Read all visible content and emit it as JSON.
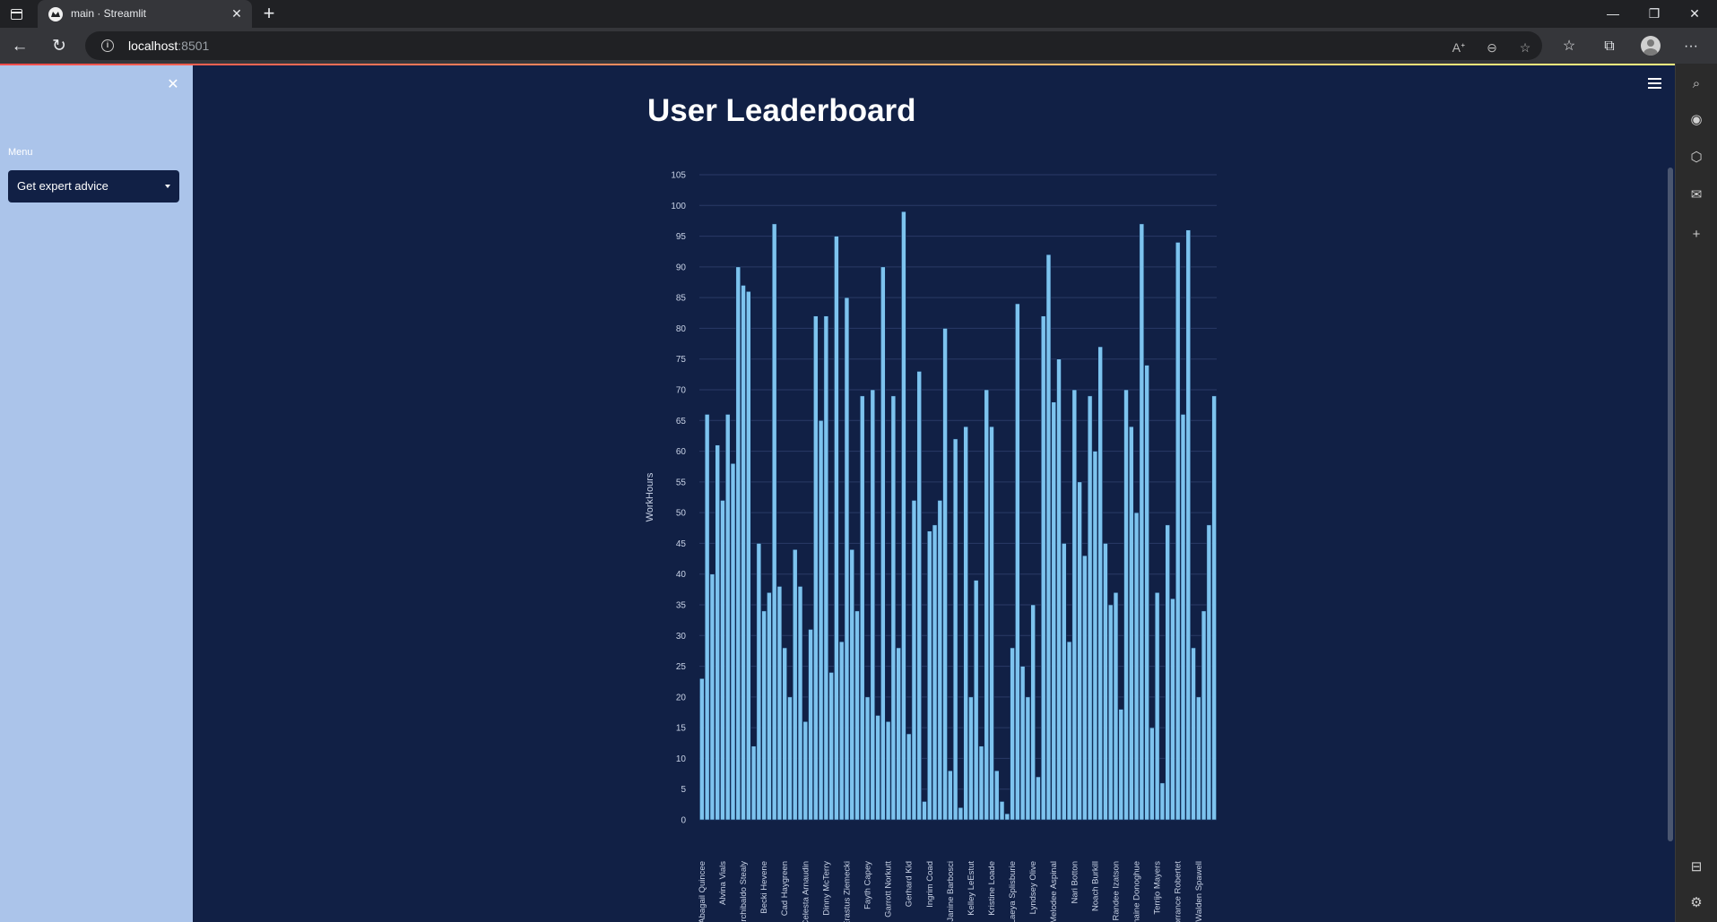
{
  "browser": {
    "tab_title": "main · Streamlit",
    "url_host": "localhost",
    "url_port": ":8501"
  },
  "sidebar": {
    "label": "Menu",
    "select_value": "Get expert advice"
  },
  "page": {
    "title": "User Leaderboard"
  },
  "colors": {
    "app_bg": "#112045",
    "sidebar_bg": "#abc4ea",
    "bar_fill": "#7dc3ee",
    "bar_stroke": "#0e2a55",
    "grid": "#2a3a66"
  },
  "chart_data": {
    "type": "bar",
    "title": "",
    "xlabel": "",
    "ylabel": "WorkHours",
    "ylim": [
      0,
      105
    ],
    "yticks": [
      0,
      5,
      10,
      15,
      20,
      25,
      30,
      35,
      40,
      45,
      50,
      55,
      60,
      65,
      70,
      75,
      80,
      85,
      90,
      95,
      100,
      105
    ],
    "grid": true,
    "values": [
      23,
      66,
      40,
      61,
      52,
      66,
      58,
      90,
      87,
      86,
      12,
      45,
      34,
      37,
      97,
      38,
      28,
      20,
      44,
      38,
      16,
      31,
      82,
      65,
      82,
      24,
      95,
      29,
      85,
      44,
      34,
      69,
      20,
      70,
      17,
      90,
      16,
      69,
      28,
      99,
      14,
      52,
      73,
      3,
      47,
      48,
      52,
      80,
      8,
      62,
      2,
      64,
      20,
      39,
      12,
      70,
      64,
      8,
      3,
      1,
      28,
      84,
      25,
      20,
      35,
      7,
      82,
      92,
      68,
      75,
      45,
      29,
      70,
      55,
      43,
      69,
      60,
      77,
      45,
      35,
      37,
      18,
      70,
      64,
      50,
      97,
      74,
      15,
      37,
      6,
      48,
      36,
      94,
      66,
      96,
      28,
      20,
      34,
      48,
      69
    ],
    "tick_labels": [
      {
        "index": 0,
        "label": "Abagail Quincee"
      },
      {
        "index": 4,
        "label": "Alvina Vials"
      },
      {
        "index": 8,
        "label": "Archibaldo Stealy"
      },
      {
        "index": 12,
        "label": "Becki Hevene"
      },
      {
        "index": 16,
        "label": "Cad Haygreen"
      },
      {
        "index": 20,
        "label": "Celesta Arnaudin"
      },
      {
        "index": 24,
        "label": "Dinny McTerry"
      },
      {
        "index": 28,
        "label": "Erastus Ziemecki"
      },
      {
        "index": 32,
        "label": "Fayth Capey"
      },
      {
        "index": 36,
        "label": "Garrott Norkutt"
      },
      {
        "index": 40,
        "label": "Gerhard Kid"
      },
      {
        "index": 44,
        "label": "Ingrim Coad"
      },
      {
        "index": 48,
        "label": "Janine Barbosci"
      },
      {
        "index": 52,
        "label": "Kelley LeEstut"
      },
      {
        "index": 56,
        "label": "Kristine Loade"
      },
      {
        "index": 60,
        "label": "Laeya Splisburie"
      },
      {
        "index": 64,
        "label": "Lyndsey Olive"
      },
      {
        "index": 68,
        "label": "Melodee Aspinal"
      },
      {
        "index": 72,
        "label": "Nari Botton"
      },
      {
        "index": 76,
        "label": "Noach Burkill"
      },
      {
        "index": 80,
        "label": "Randee Izatson"
      },
      {
        "index": 84,
        "label": "Shaine Donoghue"
      },
      {
        "index": 88,
        "label": "Terrijo Mayers"
      },
      {
        "index": 92,
        "label": "Torrance Robertet"
      },
      {
        "index": 96,
        "label": "Walden Spawell"
      }
    ]
  }
}
